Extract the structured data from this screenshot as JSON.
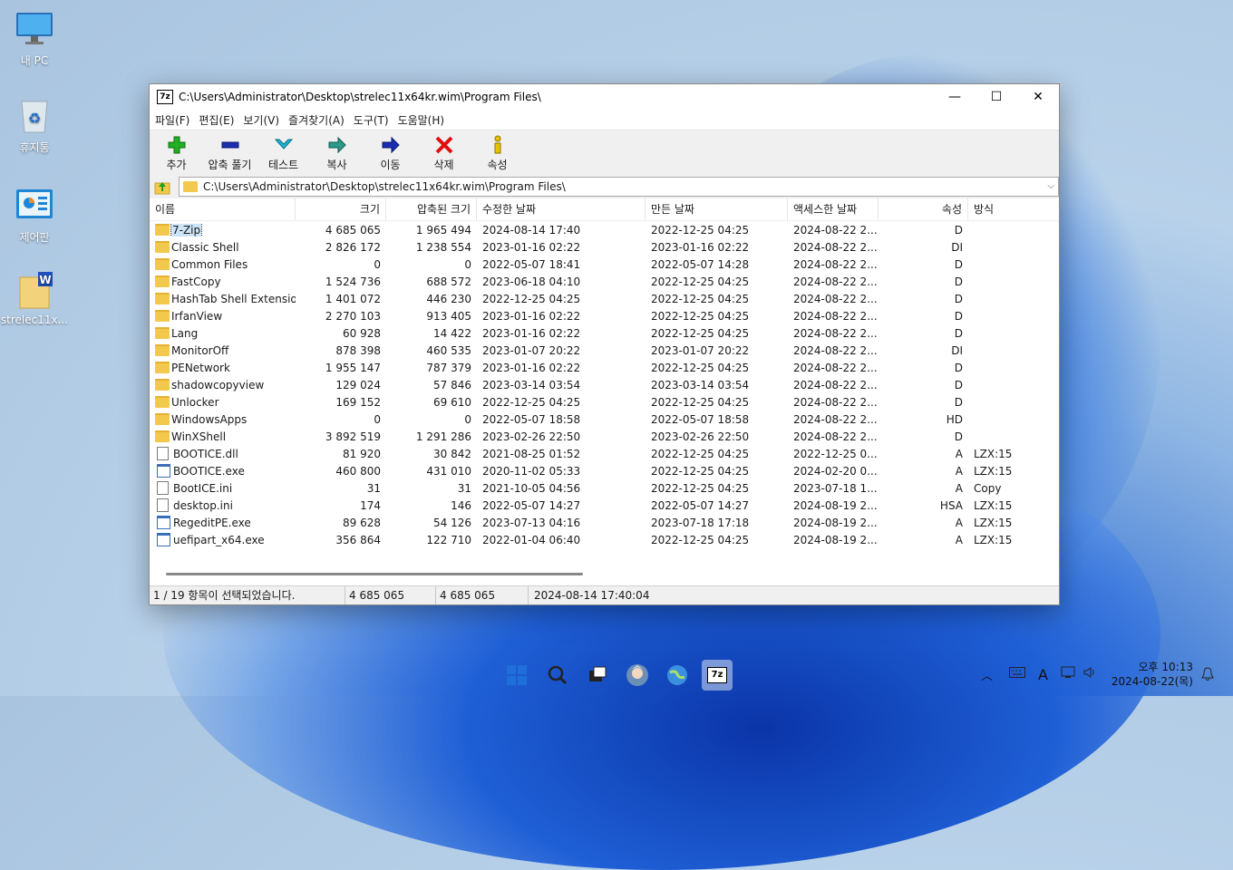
{
  "desktop": {
    "icons": [
      {
        "label": "내 PC",
        "icon": "monitor-icon"
      },
      {
        "label": "휴지통",
        "icon": "recycle-bin-icon"
      },
      {
        "label": "제어판",
        "icon": "control-panel-icon"
      },
      {
        "label": "strelec11x...",
        "icon": "wim-file-icon"
      }
    ]
  },
  "window": {
    "title": "C:\\Users\\Administrator\\Desktop\\strelec11x64kr.wim\\Program Files\\",
    "logo": "7z",
    "controls": {
      "minimize": "—",
      "maximize": "☐",
      "close": "✕"
    }
  },
  "menu": [
    "파일(F)",
    "편집(E)",
    "보기(V)",
    "즐겨찾기(A)",
    "도구(T)",
    "도움말(H)"
  ],
  "toolbar": [
    {
      "label": "추가",
      "icon": "add-icon",
      "color": "#22b022"
    },
    {
      "label": "압축 풀기",
      "icon": "extract-icon",
      "color": "#1a2fb0"
    },
    {
      "label": "테스트",
      "icon": "test-icon",
      "color": "#19b8d8"
    },
    {
      "label": "복사",
      "icon": "copy-icon",
      "color": "#2a9a8a"
    },
    {
      "label": "이동",
      "icon": "move-icon",
      "color": "#1a2fb0"
    },
    {
      "label": "삭제",
      "icon": "delete-icon",
      "color": "#e01010"
    },
    {
      "label": "속성",
      "icon": "info-icon",
      "color": "#e8c400"
    }
  ],
  "address": {
    "path": "C:\\Users\\Administrator\\Desktop\\strelec11x64kr.wim\\Program Files\\"
  },
  "columns": [
    "이름",
    "크기",
    "압축된 크기",
    "수정한 날짜",
    "만든 날짜",
    "액세스한 날짜",
    "속성",
    "방식"
  ],
  "files": [
    {
      "name": "7-Zip",
      "type": "folder",
      "size": "4 685 065",
      "packed": "1 965 494",
      "modified": "2024-08-14 17:40",
      "created": "2022-12-25 04:25",
      "accessed": "2024-08-22 2...",
      "attr": "D",
      "method": "",
      "selected": true
    },
    {
      "name": "Classic Shell",
      "type": "folder",
      "size": "2 826 172",
      "packed": "1 238 554",
      "modified": "2023-01-16 02:22",
      "created": "2023-01-16 02:22",
      "accessed": "2024-08-22 2...",
      "attr": "DI",
      "method": ""
    },
    {
      "name": "Common Files",
      "type": "folder",
      "size": "0",
      "packed": "0",
      "modified": "2022-05-07 18:41",
      "created": "2022-05-07 14:28",
      "accessed": "2024-08-22 2...",
      "attr": "D",
      "method": ""
    },
    {
      "name": "FastCopy",
      "type": "folder",
      "size": "1 524 736",
      "packed": "688 572",
      "modified": "2023-06-18 04:10",
      "created": "2022-12-25 04:25",
      "accessed": "2024-08-22 2...",
      "attr": "D",
      "method": ""
    },
    {
      "name": "HashTab Shell Extension",
      "type": "folder",
      "size": "1 401 072",
      "packed": "446 230",
      "modified": "2022-12-25 04:25",
      "created": "2022-12-25 04:25",
      "accessed": "2024-08-22 2...",
      "attr": "D",
      "method": ""
    },
    {
      "name": "IrfanView",
      "type": "folder",
      "size": "2 270 103",
      "packed": "913 405",
      "modified": "2023-01-16 02:22",
      "created": "2022-12-25 04:25",
      "accessed": "2024-08-22 2...",
      "attr": "D",
      "method": ""
    },
    {
      "name": "Lang",
      "type": "folder",
      "size": "60 928",
      "packed": "14 422",
      "modified": "2023-01-16 02:22",
      "created": "2022-12-25 04:25",
      "accessed": "2024-08-22 2...",
      "attr": "D",
      "method": ""
    },
    {
      "name": "MonitorOff",
      "type": "folder",
      "size": "878 398",
      "packed": "460 535",
      "modified": "2023-01-07 20:22",
      "created": "2023-01-07 20:22",
      "accessed": "2024-08-22 2...",
      "attr": "DI",
      "method": ""
    },
    {
      "name": "PENetwork",
      "type": "folder",
      "size": "1 955 147",
      "packed": "787 379",
      "modified": "2023-01-16 02:22",
      "created": "2022-12-25 04:25",
      "accessed": "2024-08-22 2...",
      "attr": "D",
      "method": ""
    },
    {
      "name": "shadowcopyview",
      "type": "folder",
      "size": "129 024",
      "packed": "57 846",
      "modified": "2023-03-14 03:54",
      "created": "2023-03-14 03:54",
      "accessed": "2024-08-22 2...",
      "attr": "D",
      "method": ""
    },
    {
      "name": "Unlocker",
      "type": "folder",
      "size": "169 152",
      "packed": "69 610",
      "modified": "2022-12-25 04:25",
      "created": "2022-12-25 04:25",
      "accessed": "2024-08-22 2...",
      "attr": "D",
      "method": ""
    },
    {
      "name": "WindowsApps",
      "type": "folder",
      "size": "0",
      "packed": "0",
      "modified": "2022-05-07 18:58",
      "created": "2022-05-07 18:58",
      "accessed": "2024-08-22 2...",
      "attr": "HD",
      "method": ""
    },
    {
      "name": "WinXShell",
      "type": "folder",
      "size": "3 892 519",
      "packed": "1 291 286",
      "modified": "2023-02-26 22:50",
      "created": "2023-02-26 22:50",
      "accessed": "2024-08-22 2...",
      "attr": "D",
      "method": ""
    },
    {
      "name": "BOOTICE.dll",
      "type": "file",
      "size": "81 920",
      "packed": "30 842",
      "modified": "2021-08-25 01:52",
      "created": "2022-12-25 04:25",
      "accessed": "2022-12-25 0...",
      "attr": "A",
      "method": "LZX:15"
    },
    {
      "name": "BOOTICE.exe",
      "type": "exe",
      "size": "460 800",
      "packed": "431 010",
      "modified": "2020-11-02 05:33",
      "created": "2022-12-25 04:25",
      "accessed": "2024-02-20 0...",
      "attr": "A",
      "method": "LZX:15"
    },
    {
      "name": "BootICE.ini",
      "type": "file",
      "size": "31",
      "packed": "31",
      "modified": "2021-10-05 04:56",
      "created": "2022-12-25 04:25",
      "accessed": "2023-07-18 1...",
      "attr": "A",
      "method": "Copy"
    },
    {
      "name": "desktop.ini",
      "type": "file",
      "size": "174",
      "packed": "146",
      "modified": "2022-05-07 14:27",
      "created": "2022-05-07 14:27",
      "accessed": "2024-08-19 2...",
      "attr": "HSA",
      "method": "LZX:15"
    },
    {
      "name": "RegeditPE.exe",
      "type": "exe",
      "size": "89 628",
      "packed": "54 126",
      "modified": "2023-07-13 04:16",
      "created": "2023-07-18 17:18",
      "accessed": "2024-08-19 2...",
      "attr": "A",
      "method": "LZX:15"
    },
    {
      "name": "uefipart_x64.exe",
      "type": "exe",
      "size": "356 864",
      "packed": "122 710",
      "modified": "2022-01-04 06:40",
      "created": "2022-12-25 04:25",
      "accessed": "2024-08-19 2...",
      "attr": "A",
      "method": "LZX:15"
    }
  ],
  "status": {
    "selection": "1 / 19 항목이 선택되었습니다.",
    "size": "4 685 065",
    "packed": "4 685 065",
    "date": "2024-08-14 17:40:04"
  },
  "taskbar": {
    "apps": [
      "start-icon",
      "search-icon",
      "task-view-icon",
      "avatar-app-icon",
      "globe-icon",
      "7zip-icon"
    ],
    "tray": {
      "ime": "A"
    },
    "clock": {
      "time": "오후 10:13",
      "date": "2024-08-22(목)"
    }
  }
}
